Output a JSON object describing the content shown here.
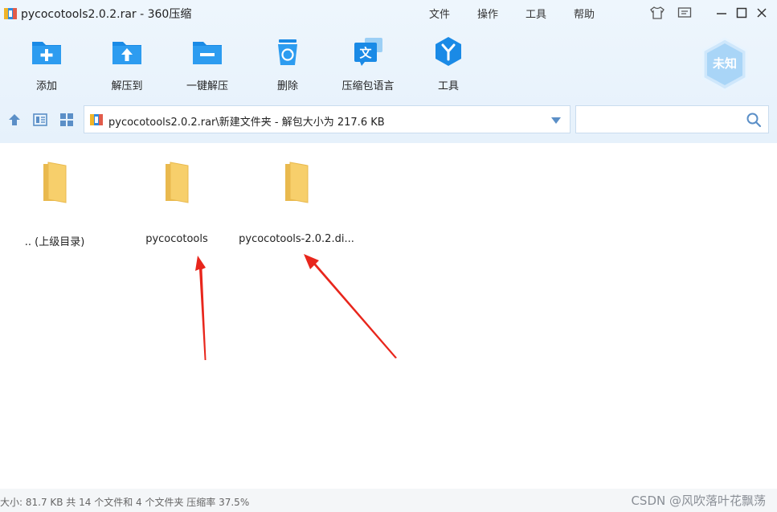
{
  "window": {
    "title": "pycocotools2.0.2.rar - 360压缩"
  },
  "menu": {
    "items": [
      "文件",
      "操作",
      "工具",
      "帮助"
    ]
  },
  "window_controls": [
    "skin-icon",
    "feedback-icon",
    "minimize-icon",
    "maximize-icon",
    "close-icon"
  ],
  "toolbar": {
    "items": [
      {
        "label": "添加",
        "icon": "add-icon"
      },
      {
        "label": "解压到",
        "icon": "extract-to-icon"
      },
      {
        "label": "一键解压",
        "icon": "one-click-extract-icon"
      },
      {
        "label": "删除",
        "icon": "delete-icon"
      },
      {
        "label": "压缩包语言",
        "icon": "archive-language-icon"
      },
      {
        "label": "工具",
        "icon": "tools-icon"
      }
    ],
    "badge_label": "未知"
  },
  "address": {
    "path": "pycocotools2.0.2.rar\\新建文件夹 - 解包大小为 217.6 KB"
  },
  "search": {
    "placeholder": ""
  },
  "files": [
    {
      "name": ".. (上级目录)",
      "icon": "folder-icon"
    },
    {
      "name": "pycocotools",
      "icon": "folder-icon"
    },
    {
      "name": "pycocotools-2.0.2.di...",
      "icon": "folder-icon"
    }
  ],
  "status": {
    "text": "大小: 81.7 KB 共 14 个文件和 4 个文件夹 压缩率 37.5%",
    "watermark": "CSDN @风吹落叶花飘荡"
  },
  "colors": {
    "accent": "#1a8ae6",
    "folder": "#f7cf6b",
    "annotation_arrow": "#e8261c",
    "toolbar_bg": "#eaf3fc"
  }
}
